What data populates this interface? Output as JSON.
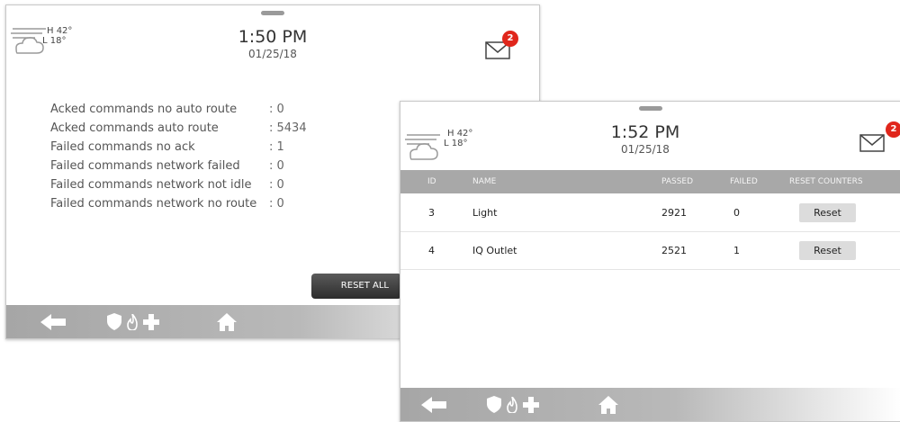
{
  "screen1": {
    "weather": {
      "high": "H 42°",
      "low": "L 18°"
    },
    "clock": {
      "time": "1:50 PM",
      "date": "01/25/18"
    },
    "mail_count": "2",
    "stats": [
      {
        "label": "Acked commands no auto route",
        "value": ": 0"
      },
      {
        "label": "Acked commands auto route",
        "value": ": 5434"
      },
      {
        "label": "Failed commands no ack",
        "value": ": 1"
      },
      {
        "label": "Failed commands network failed",
        "value": ": 0"
      },
      {
        "label": "Failed commands network not idle",
        "value": ": 0"
      },
      {
        "label": "Failed commands network no route",
        "value": ": 0"
      }
    ],
    "reset_all_label": "RESET ALL"
  },
  "screen2": {
    "weather": {
      "high": "H 42°",
      "low": "L 18°"
    },
    "clock": {
      "time": "1:52 PM",
      "date": "01/25/18"
    },
    "mail_count": "2",
    "columns": {
      "id": "ID",
      "name": "NAME",
      "passed": "PASSED",
      "failed": "FAILED",
      "reset": "RESET COUNTERS"
    },
    "rows": [
      {
        "id": "3",
        "name": "Light",
        "passed": "2921",
        "failed": "0",
        "reset": "Reset"
      },
      {
        "id": "4",
        "name": "IQ Outlet",
        "passed": "2521",
        "failed": "1",
        "reset": "Reset"
      }
    ]
  },
  "nav_icons": [
    "back-arrow-icon",
    "shield-icon",
    "fire-icon",
    "medical-cross-icon",
    "home-icon"
  ],
  "colors": {
    "badge": "#e0261b",
    "navbar": "#a6a6a6",
    "table_header": "#a8a8a8",
    "reset_all_button": "#3a3a3a"
  }
}
